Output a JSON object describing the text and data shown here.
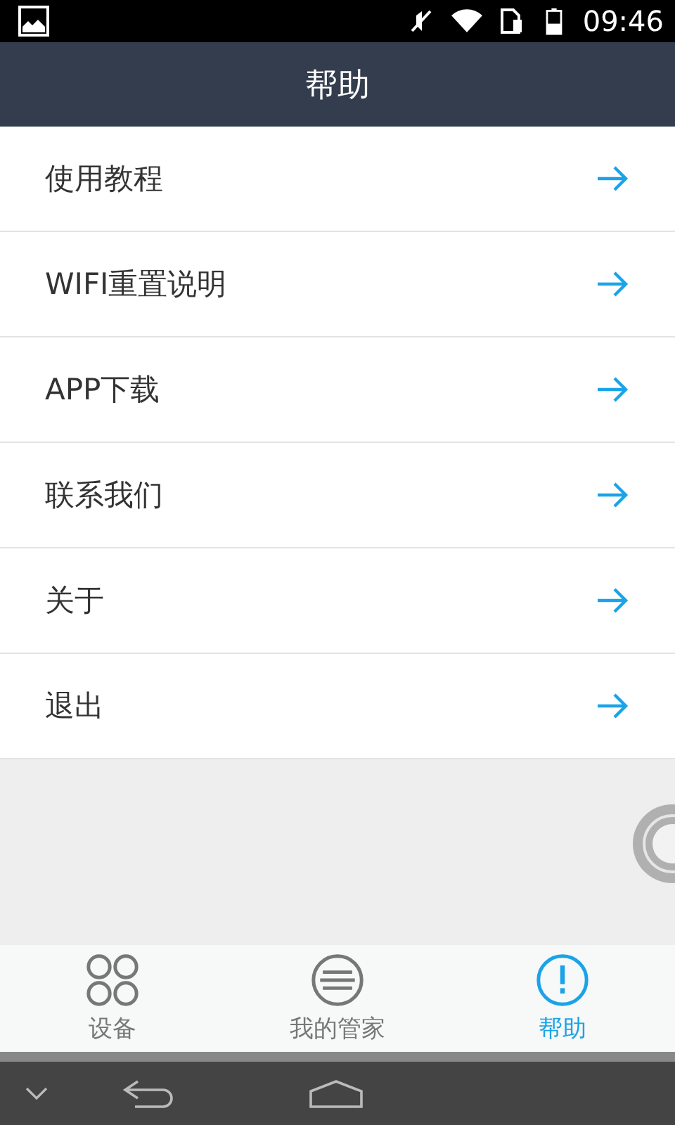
{
  "status_bar": {
    "time": "09:46"
  },
  "header": {
    "title": "帮助"
  },
  "menu_items": [
    {
      "label": "使用教程"
    },
    {
      "label": "WIFI重置说明"
    },
    {
      "label": "APP下载"
    },
    {
      "label": "联系我们"
    },
    {
      "label": "关于"
    },
    {
      "label": "退出"
    }
  ],
  "tabs": [
    {
      "label": "设备",
      "kind": "grid",
      "selected": false
    },
    {
      "label": "我的管家",
      "kind": "list",
      "selected": false
    },
    {
      "label": "帮助",
      "kind": "info",
      "selected": true
    }
  ]
}
